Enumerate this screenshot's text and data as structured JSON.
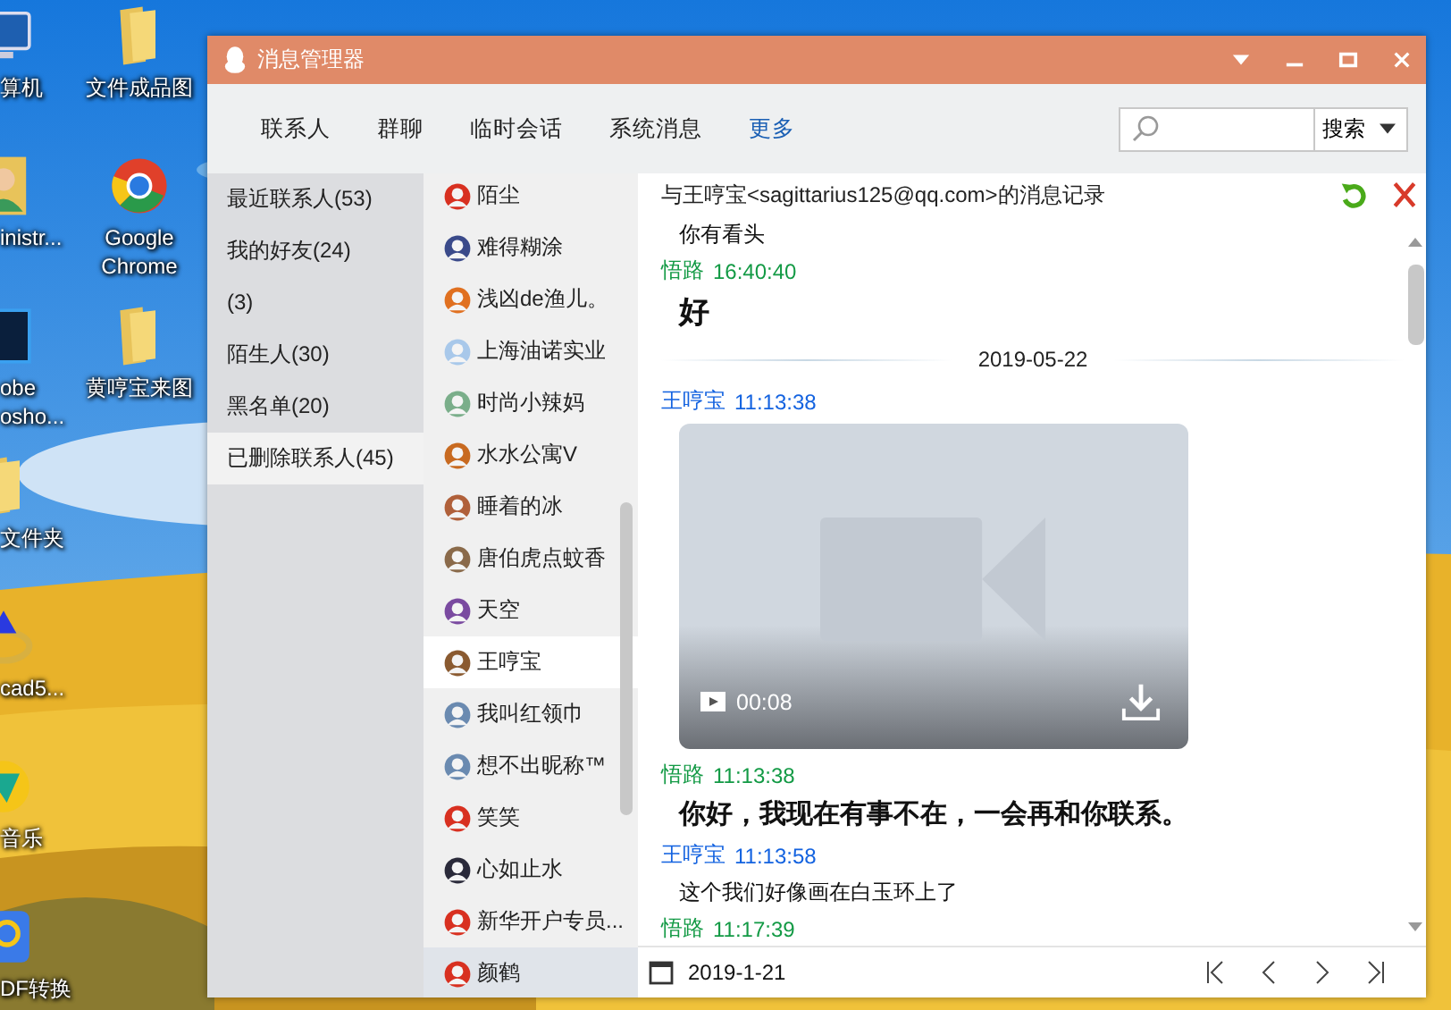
{
  "desktop": {
    "icons_left": [
      {
        "label": "算机",
        "kind": "monitor"
      },
      {
        "label": "inistr...",
        "kind": "user"
      },
      {
        "label": "obe osho...",
        "kind": "ps"
      },
      {
        "label": "文件夹",
        "kind": "folder"
      },
      {
        "label": "cad5...",
        "kind": "ring"
      },
      {
        "label": "音乐",
        "kind": "music"
      },
      {
        "label": "DF转换",
        "kind": "pdf"
      }
    ],
    "icons_right": [
      {
        "label": "文件成品图",
        "kind": "folder"
      },
      {
        "label": "Google Chrome",
        "kind": "browser"
      },
      {
        "label": "黄哼宝来图",
        "kind": "folder"
      }
    ]
  },
  "window": {
    "title": "消息管理器"
  },
  "tabs": [
    {
      "label": "联系人",
      "kind": "tab"
    },
    {
      "label": "群聊",
      "kind": "tab"
    },
    {
      "label": "临时会话",
      "kind": "tab"
    },
    {
      "label": "系统消息",
      "kind": "tab"
    },
    {
      "label": "更多",
      "kind": "link"
    }
  ],
  "search": {
    "button": "搜索"
  },
  "categories": [
    {
      "label": "最近联系人(53)",
      "selected": false
    },
    {
      "label": "我的好友(24)",
      "selected": false
    },
    {
      "label": "(3)",
      "selected": false
    },
    {
      "label": "陌生人(30)",
      "selected": false
    },
    {
      "label": "黑名单(20)",
      "selected": false
    },
    {
      "label": "已删除联系人(45)",
      "selected": true
    }
  ],
  "contacts": [
    {
      "name": "陌尘",
      "color": "#d83020",
      "selected": false,
      "hovered": false
    },
    {
      "name": "难得糊涂",
      "color": "#3a4a8a",
      "selected": false,
      "hovered": false
    },
    {
      "name": "浅凶de渔儿。",
      "color": "#e07020",
      "selected": false,
      "hovered": false
    },
    {
      "name": "上海油诺实业",
      "color": "#a8c8ea",
      "selected": false,
      "hovered": false
    },
    {
      "name": "时尚小辣妈",
      "color": "#7aae8a",
      "selected": false,
      "hovered": false
    },
    {
      "name": "水水公寓V",
      "color": "#c86a20",
      "selected": false,
      "hovered": false
    },
    {
      "name": "睡着的冰",
      "color": "#b0603a",
      "selected": false,
      "hovered": false
    },
    {
      "name": "唐伯虎点蚊香",
      "color": "#8a6a4a",
      "selected": false,
      "hovered": false
    },
    {
      "name": "天空",
      "color": "#7a4aa0",
      "selected": false,
      "hovered": false
    },
    {
      "name": "王哼宝",
      "color": "#8a5a30",
      "selected": true,
      "hovered": false
    },
    {
      "name": "我叫红领巾",
      "color": "#6a8ab0",
      "selected": false,
      "hovered": false
    },
    {
      "name": "想不出昵称™",
      "color": "#6a8ab0",
      "selected": false,
      "hovered": false
    },
    {
      "name": "笑笑",
      "color": "#d83020",
      "selected": false,
      "hovered": false
    },
    {
      "name": "心如止水",
      "color": "#2a2a3a",
      "selected": false,
      "hovered": false
    },
    {
      "name": "新华开户专员...",
      "color": "#d83020",
      "selected": false,
      "hovered": false
    },
    {
      "name": "颜鹤",
      "color": "#d83020",
      "selected": false,
      "hovered": true
    }
  ],
  "conversation": {
    "title": "与王哼宝<sagittarius125@qq.com>的消息记录",
    "entries": [
      {
        "kind": "text",
        "text": "你有看头"
      },
      {
        "kind": "sent_header",
        "sender": "悟路",
        "time": "16:40:40"
      },
      {
        "kind": "large_text",
        "text": "好"
      },
      {
        "kind": "divider",
        "text": "2019-05-22"
      },
      {
        "kind": "received_header",
        "sender": "王哼宝",
        "time": "11:13:38"
      },
      {
        "kind": "video",
        "duration": "00:08"
      },
      {
        "kind": "sent_header",
        "sender": "悟路",
        "time": "11:13:38"
      },
      {
        "kind": "bold_text",
        "text": "你好，我现在有事不在，一会再和你联系。"
      },
      {
        "kind": "received_header",
        "sender": "王哼宝",
        "time": "11:13:58"
      },
      {
        "kind": "text",
        "text": "这个我们好像画在白玉环上了"
      },
      {
        "kind": "sent_header",
        "sender": "悟路",
        "time": "11:17:39"
      }
    ]
  },
  "footer": {
    "date": "2019-1-21"
  }
}
